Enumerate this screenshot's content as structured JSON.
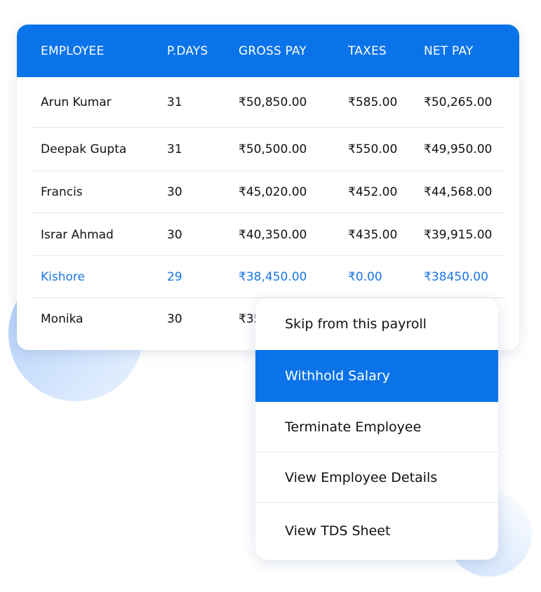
{
  "table": {
    "columns": [
      "EMPLOYEE",
      "P.DAYS",
      "GROSS PAY",
      "TAXES",
      "NET PAY"
    ],
    "rows": [
      {
        "employee": "Arun Kumar",
        "pdays": "31",
        "gross": "₹50,850.00",
        "taxes": "₹585.00",
        "net": "₹50,265.00"
      },
      {
        "employee": "Deepak Gupta",
        "pdays": "31",
        "gross": "₹50,500.00",
        "taxes": "₹550.00",
        "net": "₹49,950.00"
      },
      {
        "employee": "Francis",
        "pdays": "30",
        "gross": "₹45,020.00",
        "taxes": "₹452.00",
        "net": "₹44,568.00"
      },
      {
        "employee": "Israr Ahmad",
        "pdays": "30",
        "gross": "₹40,350.00",
        "taxes": "₹435.00",
        "net": "₹39,915.00"
      },
      {
        "employee": "Kishore",
        "pdays": "29",
        "gross": "₹38,450.00",
        "taxes": "₹0.00",
        "net": "₹38450.00",
        "highlighted": true
      },
      {
        "employee": "Monika",
        "pdays": "30",
        "gross": "₹35",
        "taxes": "",
        "net": ""
      }
    ]
  },
  "context_menu": {
    "items": [
      {
        "label": "Skip from this payroll"
      },
      {
        "label": "Withhold Salary",
        "active": true
      },
      {
        "label": "Terminate Employee"
      },
      {
        "label": "View Employee Details"
      },
      {
        "label": "View TDS Sheet"
      }
    ]
  },
  "colors": {
    "accent": "#0a73ea",
    "highlight_text": "#1a76e6"
  }
}
